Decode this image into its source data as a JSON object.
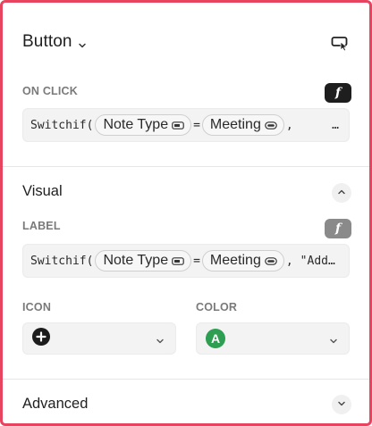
{
  "header": {
    "title": "Button"
  },
  "on_click": {
    "label": "ON CLICK",
    "fx": "f",
    "formula": {
      "fn": "Switchif(",
      "chip1": "Note Type",
      "eq": "=",
      "chip2": "Meeting",
      "sep": ",",
      "tail": "…"
    }
  },
  "visual": {
    "title": "Visual",
    "label_section": {
      "label": "LABEL",
      "fx": "f",
      "formula": {
        "fn": "Switchif(",
        "chip1": "Note Type",
        "eq": "=",
        "chip2": "Meeting",
        "sep": ",",
        "tail": "\"Add…"
      }
    },
    "icon": {
      "label": "ICON",
      "value_icon": "plus-circle-icon"
    },
    "color": {
      "label": "COLOR",
      "value_icon": "letter-a-circle-icon",
      "letter": "A",
      "swatch": "#2e9e52"
    }
  },
  "advanced": {
    "title": "Advanced"
  },
  "colors": {
    "accent_border": "#e8435f",
    "fx_active": "#1e1e1e",
    "fx_inactive": "#8a8a8a"
  }
}
